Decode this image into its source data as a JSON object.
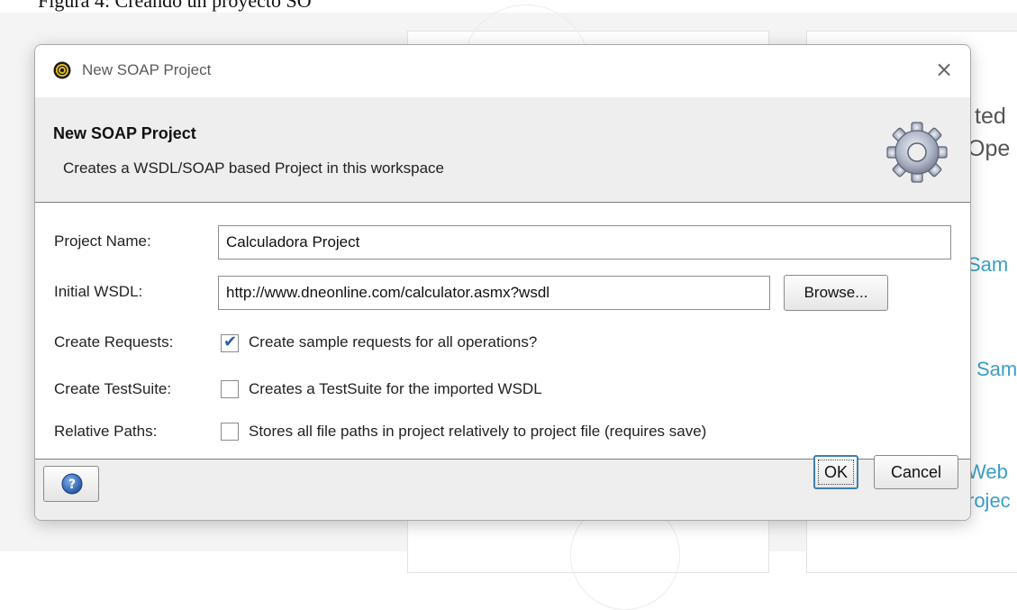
{
  "background": {
    "top_caption": "Figura 4: Creando un proyecto SO",
    "fragments": [
      "ted",
      "Ope",
      "Sam",
      "Sam",
      "Web",
      "rojec"
    ],
    "link_color": "#3a9fc6"
  },
  "dialog": {
    "window_title": "New SOAP Project",
    "close_glyph": "×",
    "header_title": "New SOAP Project",
    "header_subtitle": "Creates a WSDL/SOAP based Project in this workspace",
    "icons": {
      "app": "soapui-logo-icon",
      "header": "gear-icon",
      "help": "help-icon"
    },
    "form": {
      "project_name_label": "Project Name:",
      "project_name_value": "Calculadora Project",
      "initial_wsdl_label": "Initial WSDL:",
      "initial_wsdl_value": "http://www.dneonline.com/calculator.asmx?wsdl",
      "browse_label": "Browse...",
      "create_requests_label": "Create Requests:",
      "create_requests_checked": true,
      "create_requests_text": "Create sample requests for all operations?",
      "create_testsuite_label": "Create TestSuite:",
      "create_testsuite_checked": false,
      "create_testsuite_text": "Creates a TestSuite for the imported WSDL",
      "relative_paths_label": "Relative Paths:",
      "relative_paths_checked": false,
      "relative_paths_text": "Stores all file paths in project relatively to project file (requires save)"
    },
    "buttons": {
      "ok_label": "OK",
      "cancel_label": "Cancel"
    },
    "colors": {
      "header_bg": "#eeeeee",
      "accent": "#3c7fb1",
      "check": "#2b5fa8"
    }
  }
}
